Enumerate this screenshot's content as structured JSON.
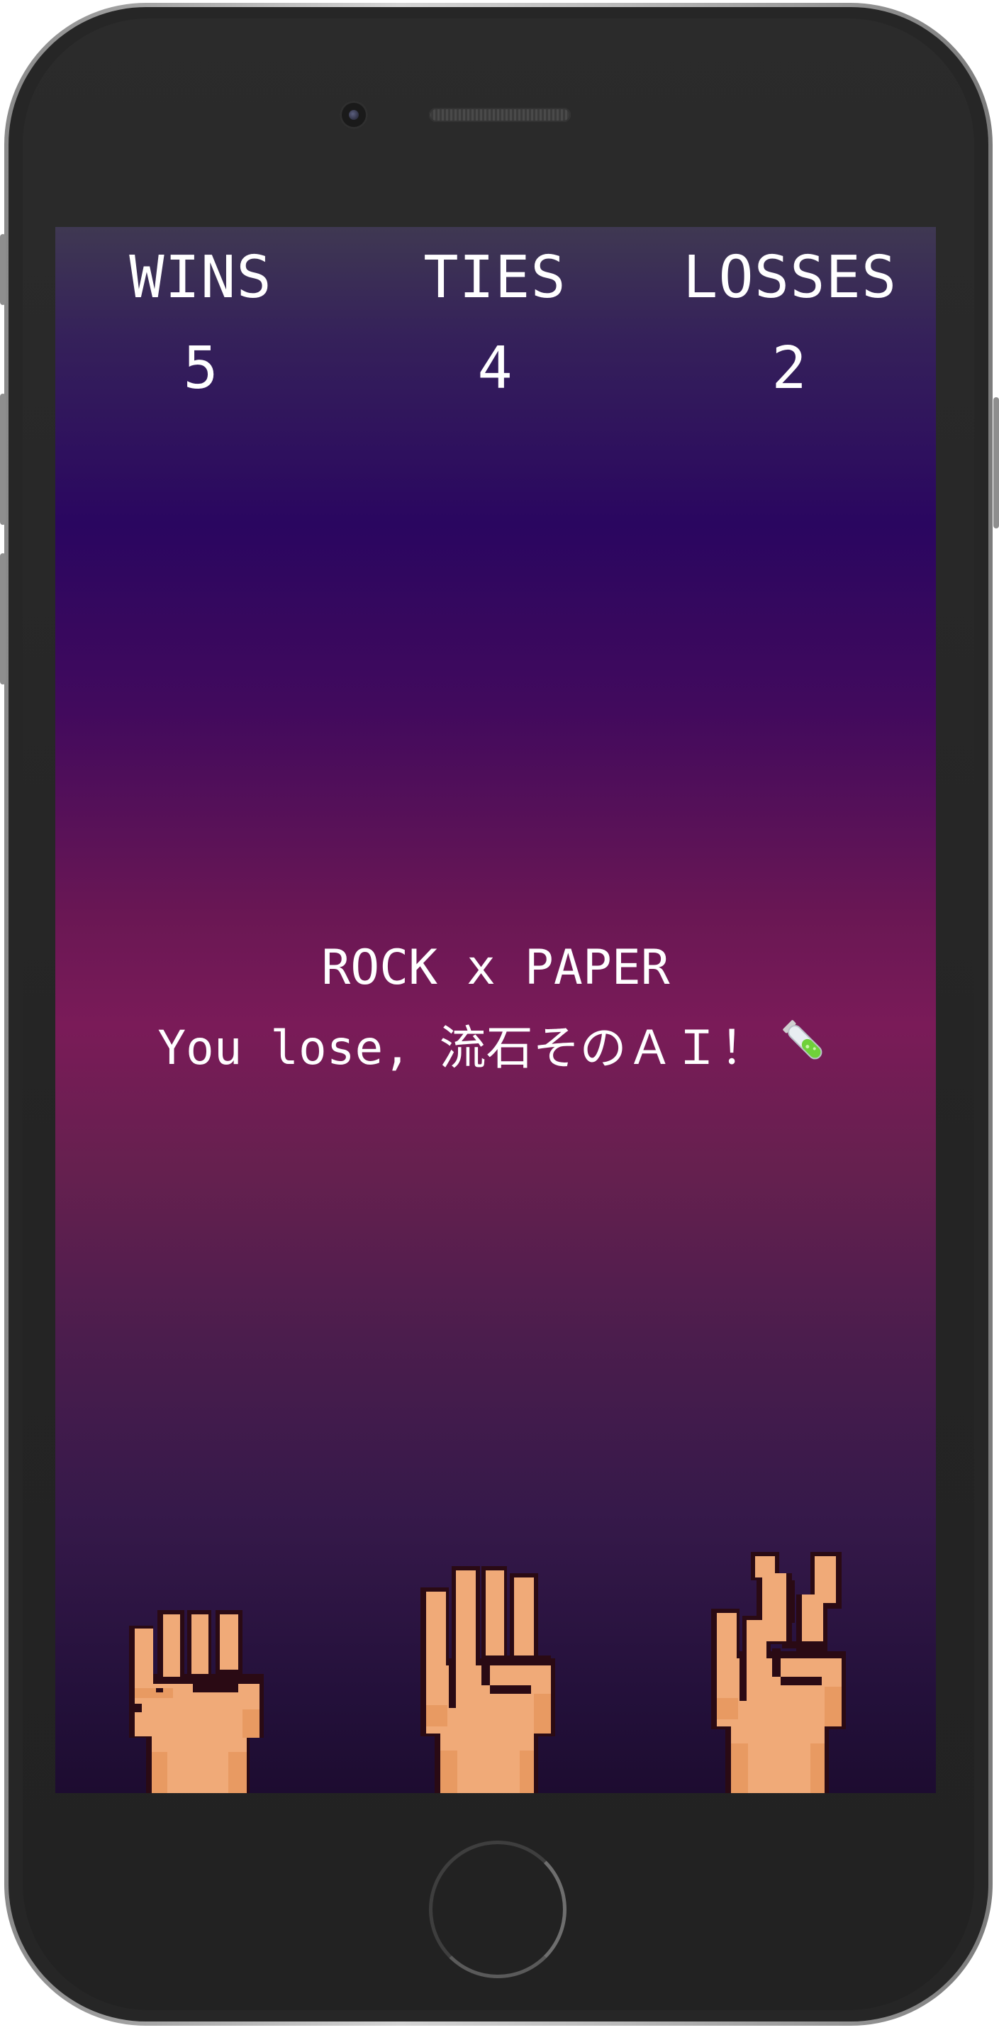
{
  "scoreboard": {
    "wins_label": "WINS",
    "wins_value": "5",
    "ties_label": "TIES",
    "ties_value": "4",
    "losses_label": "LOSSES",
    "losses_value": "2"
  },
  "result": {
    "matchup": "ROCK x PAPER",
    "message": "You lose, 流石そのＡＩ！",
    "emoji_icon": "test-tube-icon"
  },
  "choices": [
    {
      "name": "rock",
      "icon": "rock-fist-icon"
    },
    {
      "name": "paper",
      "icon": "paper-hand-icon"
    },
    {
      "name": "scissors",
      "icon": "scissors-hand-icon"
    }
  ],
  "colors": {
    "skin": "#f0aa78",
    "skin_shadow": "#e89a62",
    "outline": "#2a0a14",
    "text": "#ffffff"
  }
}
